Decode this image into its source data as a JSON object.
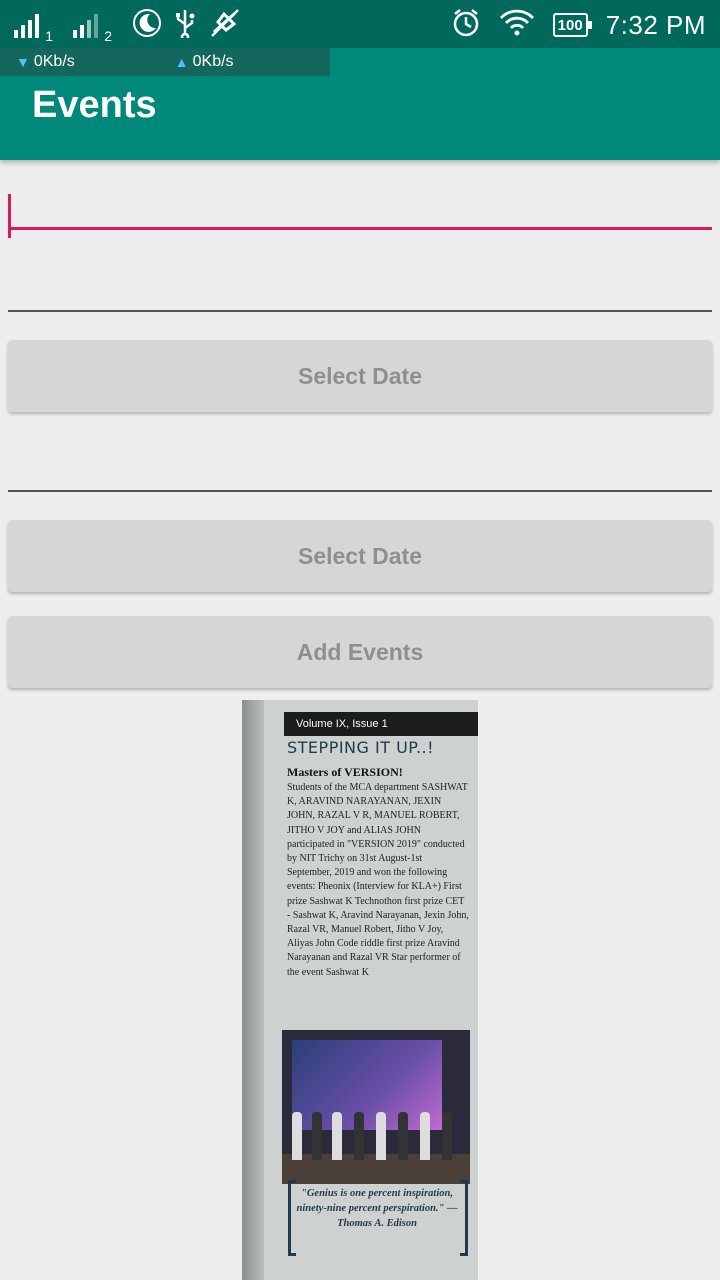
{
  "status_bar": {
    "sim1_label": "1",
    "sim2_label": "2",
    "battery": "100",
    "time": "7:32 PM",
    "download_speed": "0Kb/s",
    "upload_speed": "0Kb/s",
    "icons": [
      "signal-icon",
      "signal-icon",
      "moon-icon",
      "usb-icon",
      "no-location-icon",
      "alarm-icon",
      "wifi-icon",
      "battery-icon"
    ]
  },
  "app_bar": {
    "title": "Events"
  },
  "form": {
    "event_name": {
      "value": "",
      "placeholder": ""
    },
    "start_date_field": {
      "value": ""
    },
    "select_date_1": "Select Date",
    "end_date_field": {
      "value": ""
    },
    "select_date_2": "Select Date",
    "add_events": "Add Events"
  },
  "poster": {
    "issue": "Volume IX, Issue 1",
    "title": "STEPPING IT UP..!",
    "heading": "Masters of VERSION!",
    "body": "Students of the MCA department SASHWAT K, ARAVIND NARAYANAN, JEXIN JOHN, RAZAL V R, MANUEL ROBERT, JITHO V JOY and ALIAS JOHN participated in \"VERSION 2019\" conducted by NIT Trichy on 31st August-1st September, 2019 and won the following events: Pheonix (Interview for KLA+) First prize Sashwat K Technothon first prize CET - Sashwat K, Aravind Narayanan, Jexin John, Razal VR, Manuel Robert, Jitho V Joy, Aliyas John Code riddle first prize Aravind Narayanan and Razal VR Star performer of the event Sashwat K",
    "quote": "\"Genius is one percent inspiration, ninety-nine percent perspiration.\" — Thomas A. Edison"
  },
  "colors": {
    "status_bar": "#00695c",
    "app_bar": "#00897b",
    "accent": "#d81b60",
    "button": "#d6d6d6",
    "background": "#eeeeee"
  }
}
